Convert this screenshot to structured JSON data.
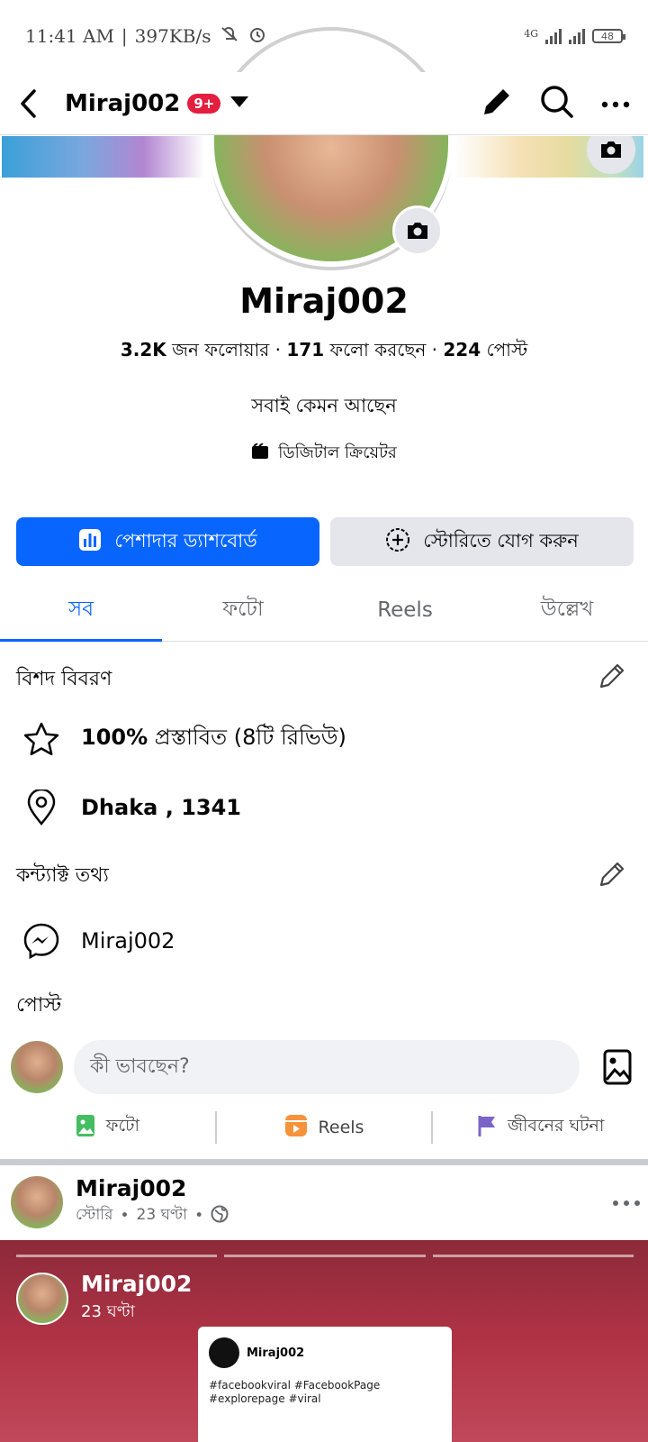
{
  "status_bar": {
    "time": "11:41 AM",
    "speed": "397KB/s",
    "network": "4G",
    "battery": "48"
  },
  "header": {
    "title": "Miraj002",
    "badge": "9+"
  },
  "profile": {
    "name": "Miraj002",
    "followers_count": "3.2K",
    "followers_label": "জন ফলোয়ার",
    "following_count": "171",
    "following_label": "ফলো করছেন",
    "posts_count": "224",
    "posts_label": "পোস্ট",
    "bio": "সবাই কেমন আছেন",
    "category": "ডিজিটাল ক্রিয়েটর"
  },
  "buttons": {
    "dashboard": "পেশাদার ড্যাশবোর্ড",
    "add_story": "স্টোরিতে যোগ করুন"
  },
  "tabs": [
    {
      "label": "সব",
      "active": true
    },
    {
      "label": "ফটো",
      "active": false
    },
    {
      "label": "Reels",
      "active": false
    },
    {
      "label": "উল্লেখ",
      "active": false
    }
  ],
  "details": {
    "title": "বিশদ বিবরণ",
    "recommend_pct": "100%",
    "recommend_text": "প্রস্তাবিত (8টি রিভিউ)",
    "location": "Dhaka , 1341"
  },
  "contact": {
    "title": "কন্ট্যাক্ট তথ্য",
    "messenger": "Miraj002"
  },
  "posts_section": {
    "title": "পোস্ট",
    "composer_placeholder": "কী ভাবছেন?",
    "actions": [
      {
        "label": "ফটো",
        "icon": "photo-icon",
        "color": "#45bd62"
      },
      {
        "label": "Reels",
        "icon": "reels-icon",
        "color": "#f7923b"
      },
      {
        "label": "জীবনের ঘটনা",
        "icon": "flag-icon",
        "color": "#7b64c8"
      }
    ]
  },
  "post": {
    "author": "Miraj002",
    "meta": "স্টোরি",
    "time": "23 ঘণ্টা",
    "story": {
      "name": "Miraj002",
      "time": "23 ঘণ্টা",
      "card_name": "Miraj002",
      "card_tags": "#facebookviral #FacebookPage #explorepage #viral"
    }
  },
  "colors": {
    "accent": "#0866ff",
    "badge": "#e41e3f"
  }
}
